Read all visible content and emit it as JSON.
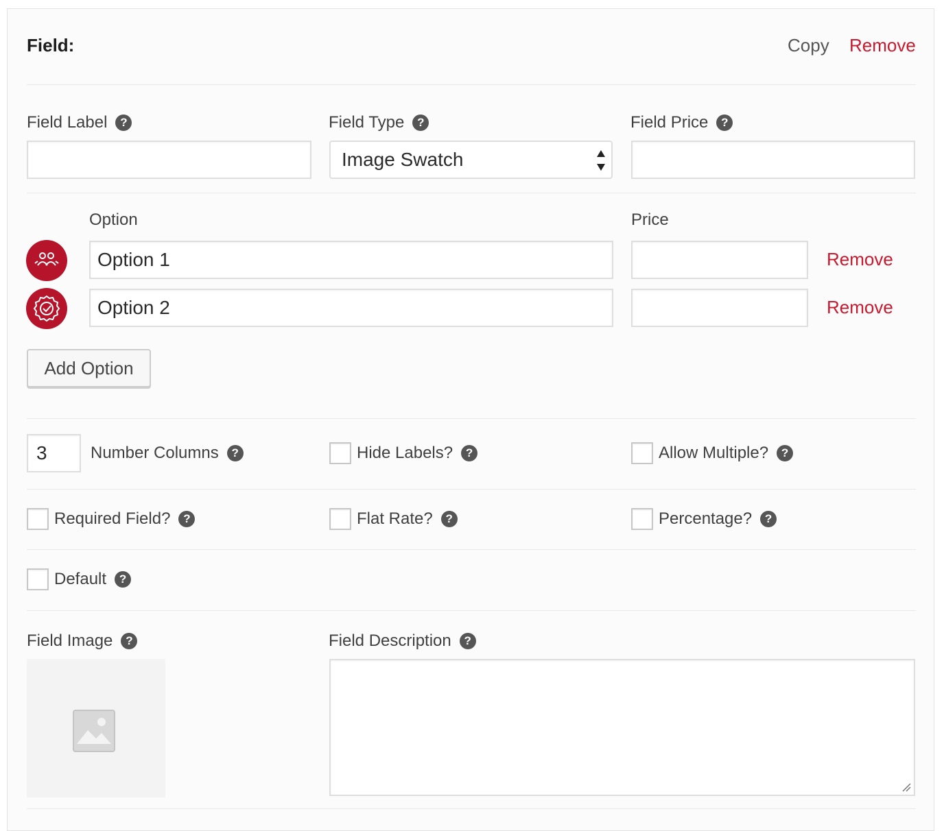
{
  "header": {
    "title": "Field:",
    "copy_label": "Copy",
    "remove_label": "Remove"
  },
  "labels": {
    "field_label": "Field Label",
    "field_type": "Field Type",
    "field_price": "Field Price"
  },
  "inputs": {
    "field_label_value": "",
    "field_type_selected": "Image Swatch",
    "field_price_value": ""
  },
  "options_table": {
    "option_header": "Option",
    "price_header": "Price",
    "rows": [
      {
        "value": "Option 1",
        "price": "",
        "remove_label": "Remove",
        "icon": "people-icon"
      },
      {
        "value": "Option 2",
        "price": "",
        "remove_label": "Remove",
        "icon": "verified-badge-icon"
      }
    ],
    "add_button_label": "Add Option"
  },
  "settings": {
    "number_columns_value": "3",
    "number_columns_label": "Number Columns",
    "hide_labels": "Hide Labels?",
    "allow_multiple": "Allow Multiple?",
    "required_field": "Required Field?",
    "flat_rate": "Flat Rate?",
    "percentage": "Percentage?",
    "default": "Default"
  },
  "bottom": {
    "field_image_label": "Field Image",
    "field_description_label": "Field Description",
    "field_description_value": ""
  },
  "help_glyph": "?",
  "colors": {
    "accent_red": "#c8192e",
    "swatch_red": "#b5142b",
    "help_icon_bg": "#555555"
  }
}
